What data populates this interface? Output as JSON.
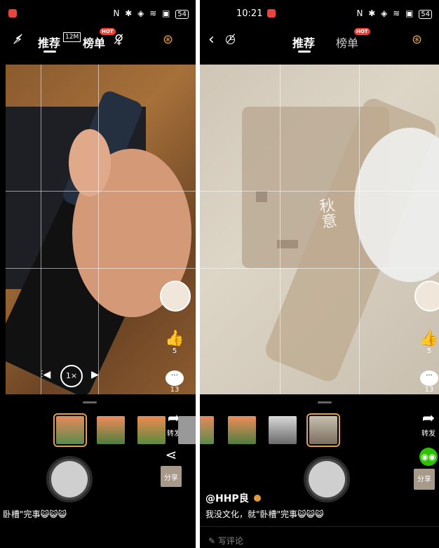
{
  "left": {
    "tabs": {
      "recommend": "推荐",
      "rank": "榜单",
      "hot": "HOT",
      "res": "12M"
    },
    "side": {
      "likes": "5",
      "comments": "13",
      "forward": "转发",
      "share": "分享"
    },
    "caption": "卧槽\"完事😺😺😺"
  },
  "right": {
    "status_time": "10:21",
    "tabs": {
      "recommend": "推荐",
      "rank": "榜单",
      "hot": "HOT"
    },
    "watermark": "秋意",
    "side": {
      "likes": "5",
      "comments": "13",
      "forward": "转发",
      "share": "分享"
    },
    "username": "@HHP良",
    "caption": "我没文化，就\"卧槽\"完事😺😺😺",
    "write_comment": "写评论"
  },
  "status": {
    "icons": "N ✱ ◈ ≋ ▣",
    "battery": "54"
  },
  "colors": {
    "accent": "#e39a3c",
    "hot": "#ff3b30",
    "wechat": "#2dc100"
  }
}
